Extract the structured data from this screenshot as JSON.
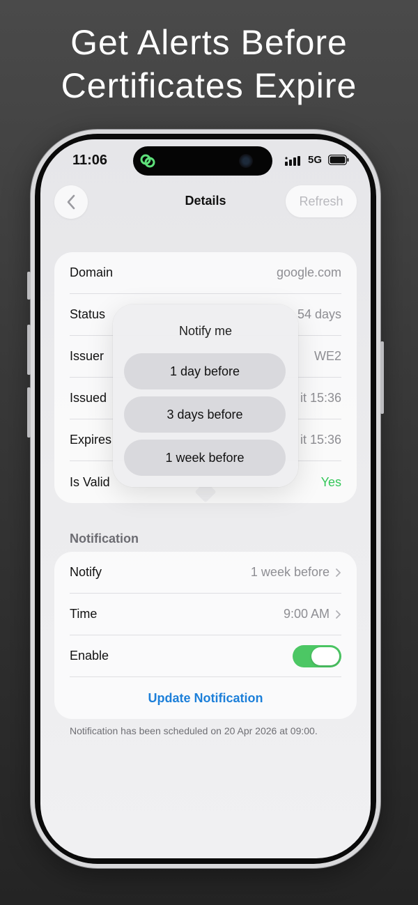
{
  "headline": {
    "line1": "Get Alerts Before",
    "line2": "Certificates Expire"
  },
  "status_bar": {
    "time": "11:06",
    "network": "5G",
    "signal_icon": "signal-bars-icon",
    "battery_icon": "battery-icon"
  },
  "nav": {
    "back_icon": "chevron-left-icon",
    "title": "Details",
    "refresh_label": "Refresh"
  },
  "details": {
    "rows": [
      {
        "label": "Domain",
        "value": "google.com"
      },
      {
        "label": "Status",
        "value": "54 days"
      },
      {
        "label": "Issuer",
        "value": "WE2"
      },
      {
        "label": "Issued",
        "value": "it 15:36"
      },
      {
        "label": "Expires",
        "value": "it 15:36"
      },
      {
        "label": "Is Valid",
        "value": "Yes"
      }
    ]
  },
  "notification": {
    "section_title": "Notification",
    "notify_label": "Notify",
    "notify_value": "1 week before",
    "time_label": "Time",
    "time_value": "9:00 AM",
    "enable_label": "Enable",
    "enabled": true,
    "update_label": "Update Notification",
    "footnote": "Notification has been scheduled on 20 Apr 2026 at 09:00."
  },
  "popover": {
    "title": "Notify me",
    "options": [
      "1 day before",
      "3 days before",
      "1 week before"
    ]
  },
  "colors": {
    "accent_blue": "#1c7fd9",
    "toggle_green": "#4cc764",
    "valid_green": "#34c759"
  }
}
